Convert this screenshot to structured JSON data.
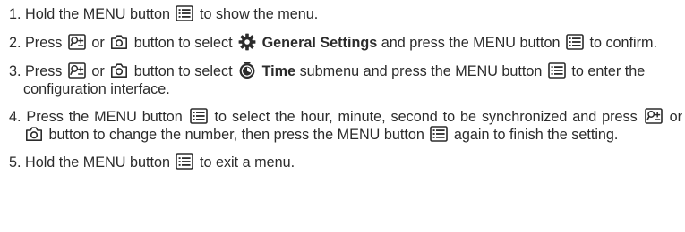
{
  "steps": [
    {
      "num": "1.",
      "parts": [
        " Hold the MENU button ",
        " to show the menu."
      ]
    },
    {
      "num": "2.",
      "parts": [
        " Press ",
        " or ",
        " button to select ",
        " ",
        " and press the MENU button ",
        " to confirm."
      ],
      "keyword": "General Settings"
    },
    {
      "num": "3.",
      "parts": [
        " Press ",
        " or ",
        " button to select ",
        " ",
        " submenu and press the MENU button ",
        " to enter the configuration interface."
      ],
      "keyword": "Time"
    },
    {
      "num": "4.",
      "parts": [
        " Press the MENU button ",
        " to select the hour, minute, second to be synchronized and press ",
        " or ",
        " button to change the number, then press the MENU button ",
        " again to finish the setting."
      ]
    },
    {
      "num": "5.",
      "parts": [
        " Hold the MENU button ",
        " to exit a menu."
      ]
    }
  ],
  "icons": {
    "menu": "menu-button-icon",
    "zoom": "zoom-button-icon",
    "camera": "camera-button-icon",
    "settings": "gear-icon",
    "time": "clock-icon"
  }
}
